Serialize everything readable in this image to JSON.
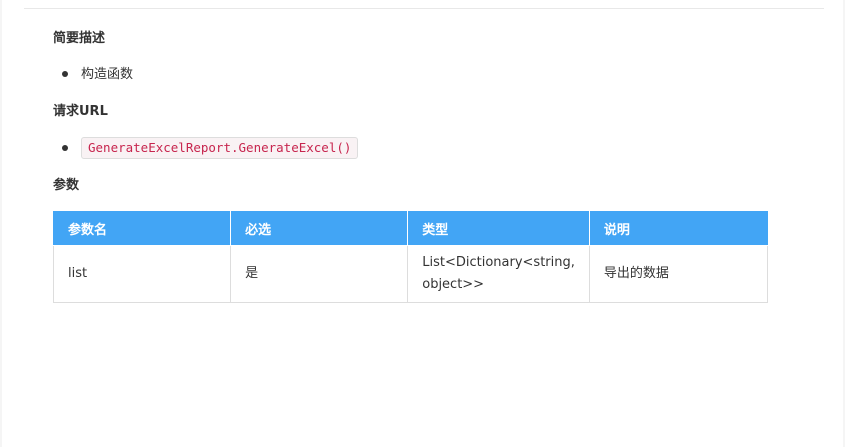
{
  "sections": {
    "summary": {
      "heading": "简要描述",
      "items": [
        "构造函数"
      ]
    },
    "request_url": {
      "heading": "请求URL",
      "code": "GenerateExcelReport.GenerateExcel()"
    },
    "params": {
      "heading": "参数",
      "columns": [
        "参数名",
        "必选",
        "类型",
        "说明"
      ],
      "rows": [
        [
          "list",
          "是",
          "List<Dictionary<string, object>>",
          "导出的数据"
        ]
      ]
    }
  },
  "colors": {
    "table_header_bg": "#42a5f5",
    "code_text": "#c7254e",
    "code_bg": "#f9f2f4"
  }
}
